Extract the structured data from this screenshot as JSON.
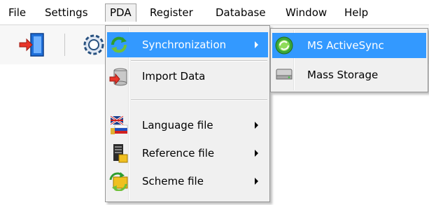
{
  "menubar": {
    "items": [
      {
        "label": "File"
      },
      {
        "label": "Settings"
      },
      {
        "label": "PDA"
      },
      {
        "label": "Register"
      },
      {
        "label": "Database"
      },
      {
        "label": "Window"
      },
      {
        "label": "Help"
      }
    ]
  },
  "toolbar": {
    "buttons": [
      {
        "icon": "exit-door-icon"
      },
      {
        "icon": "gear-icon"
      }
    ]
  },
  "pda_menu": {
    "items": [
      {
        "label": "Synchronization",
        "icon": "sync-arrows-icon",
        "has_submenu": true,
        "highlighted": true
      },
      {
        "label": "Import Data",
        "icon": "import-database-icon",
        "has_submenu": false
      },
      {
        "label": "Language file",
        "icon": "language-flags-icon",
        "has_submenu": true
      },
      {
        "label": "Reference file",
        "icon": "reference-file-icon",
        "has_submenu": true
      },
      {
        "label": "Scheme file",
        "icon": "scheme-file-icon",
        "has_submenu": true
      }
    ]
  },
  "sync_submenu": {
    "items": [
      {
        "label": "MS ActiveSync",
        "icon": "activesync-icon",
        "highlighted": true
      },
      {
        "label": "Mass Storage",
        "icon": "mass-storage-icon",
        "highlighted": false
      }
    ]
  },
  "colors": {
    "highlight": "#3399ff",
    "menu_background": "#f0f0f0"
  }
}
